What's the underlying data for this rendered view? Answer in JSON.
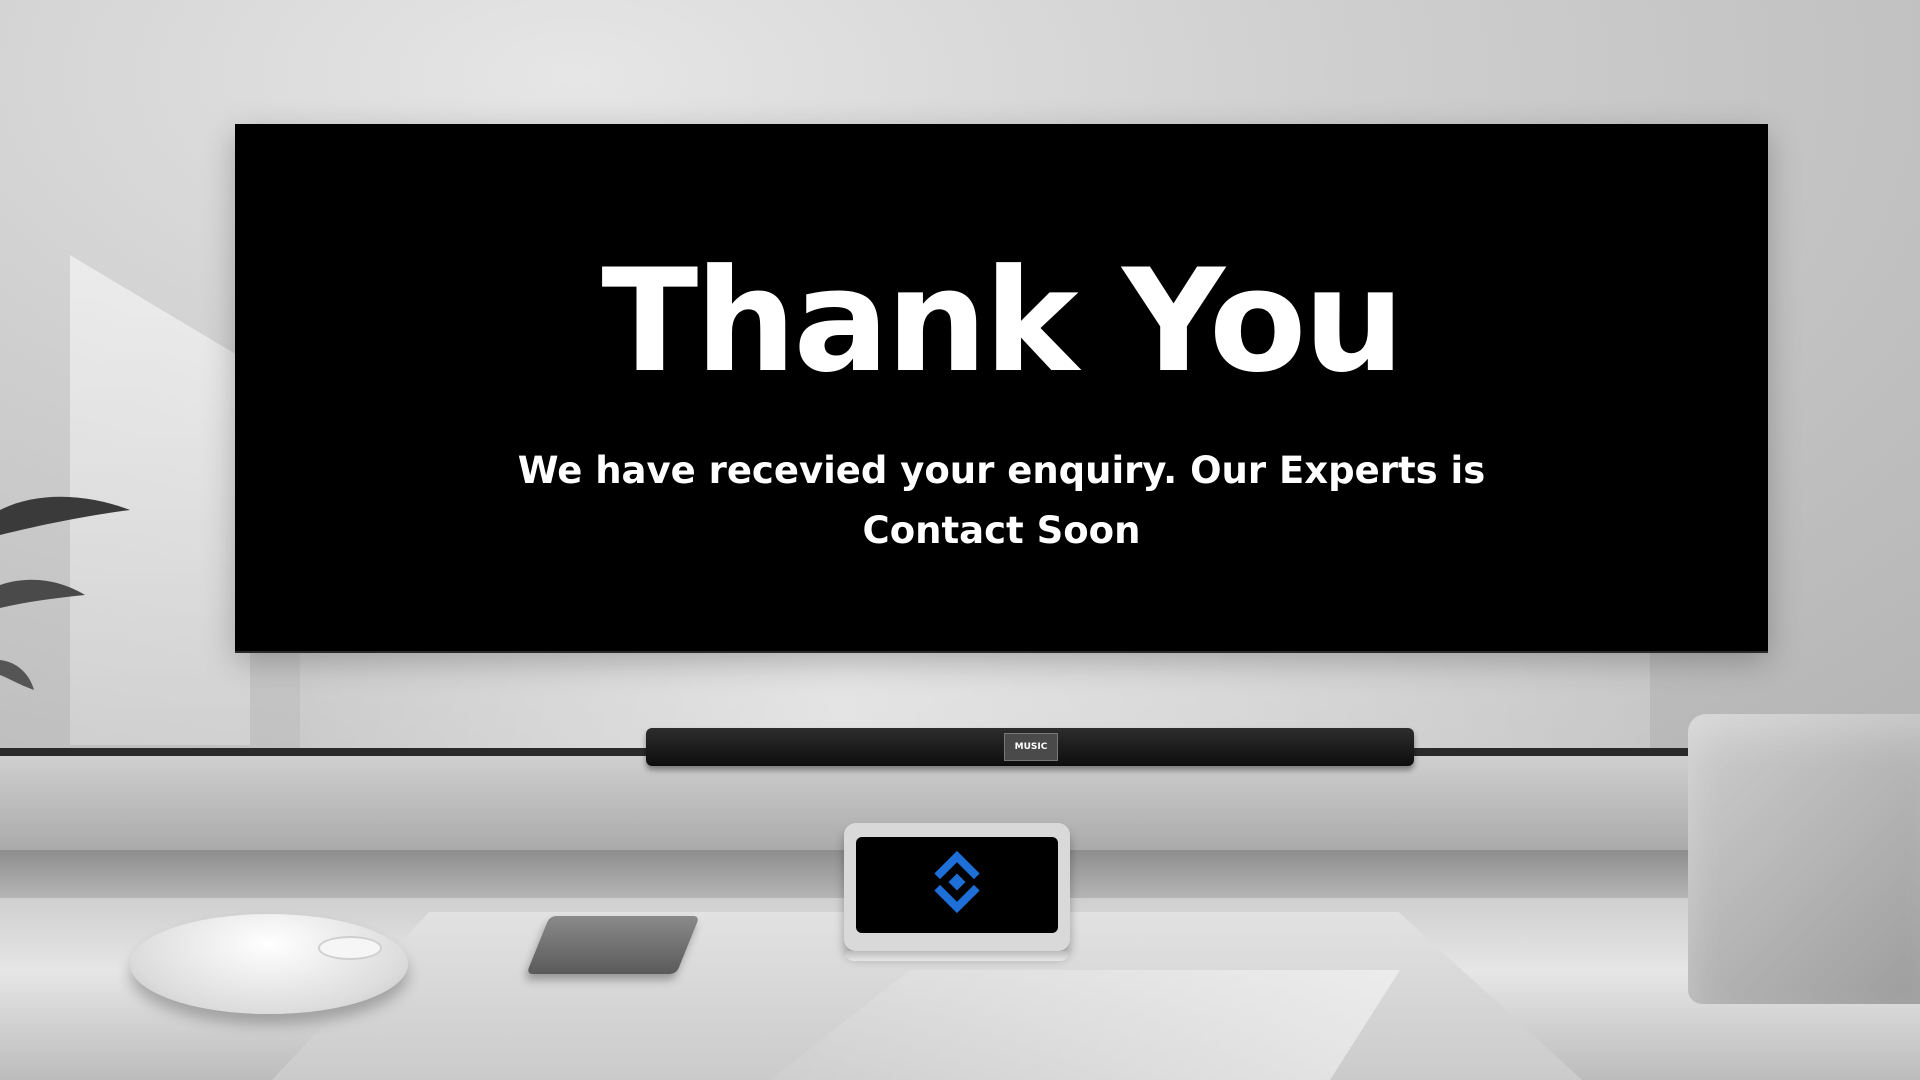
{
  "hero": {
    "title": "Thank You",
    "message": "We have recevied your enquiry. Our Experts is Contact Soon"
  },
  "soundbar": {
    "display_text": "MUSIC"
  },
  "brand": {
    "logo_color": "#1e6fd8"
  },
  "icons": {
    "logo": "brand-logo-icon"
  }
}
